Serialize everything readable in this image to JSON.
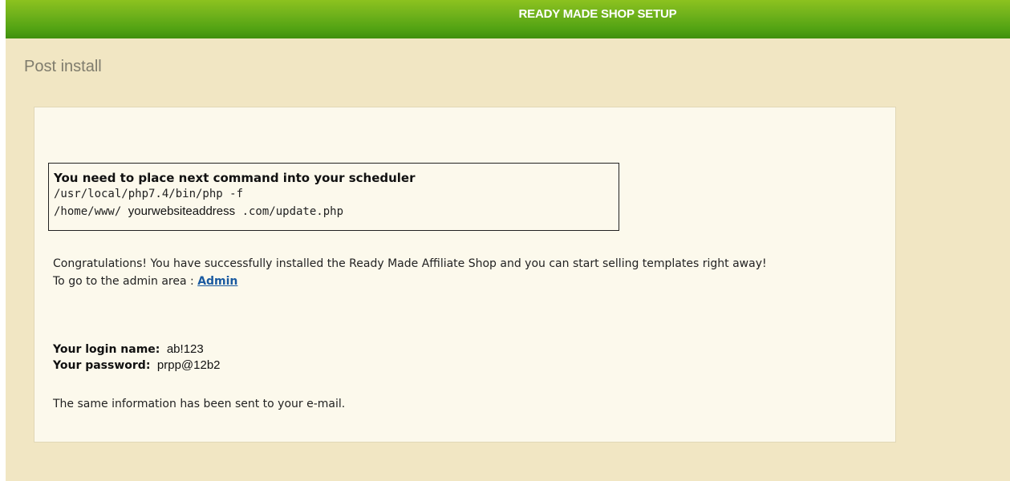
{
  "header": {
    "title": "READY MADE SHOP SETUP"
  },
  "page": {
    "title": "Post install"
  },
  "command": {
    "heading": "You need to place next command into your scheduler",
    "line1": "/usr/local/php7.4/bin/php -f",
    "line2_prefix": "/home/www/",
    "line2_domain": "yourwebsiteaddress",
    "line2_suffix": ".com/update.php"
  },
  "message": {
    "congrats": "Congratulations! You have successfully installed the Ready Made Affiliate Shop and you can start selling templates right away!",
    "admin_prefix": "To go to the admin area :",
    "admin_link": "Admin"
  },
  "credentials": {
    "login_label": "Your login name:",
    "login_value": "ab!123",
    "password_label": "Your password:",
    "password_value": "prpp@12b2"
  },
  "footer_note": "The same information has been sent to your e-mail.",
  "colors": {
    "header_green": "#52a313",
    "page_background": "#f1e6c3",
    "panel_background": "#fcf9ec",
    "link": "#1a5aa0"
  }
}
